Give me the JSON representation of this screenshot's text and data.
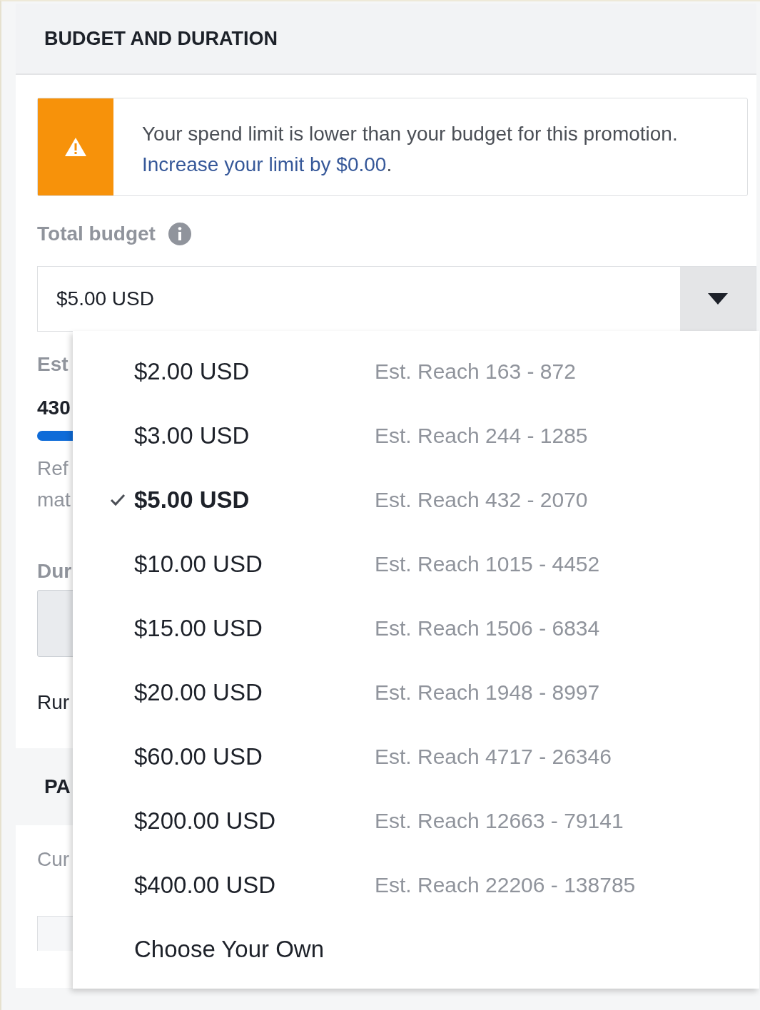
{
  "section": {
    "title": "BUDGET AND DURATION"
  },
  "warning": {
    "text": "Your spend limit is lower than your budget for this promotion.",
    "link": "Increase your limit by $0.00",
    "tail": "."
  },
  "total_budget": {
    "label": "Total budget",
    "value": "$5.00 USD"
  },
  "behind": {
    "est_label": "Est",
    "est_value": "430",
    "ref_line1": "Ref",
    "ref_line2": "mat",
    "duration_label": "Dur",
    "run_label": "Rur",
    "payment_title": "PA",
    "cur_label": "Cur"
  },
  "menu": {
    "items": [
      {
        "kind": "option",
        "amount": "$2.00 USD",
        "reach": "Est. Reach 163 - 872",
        "selected": false
      },
      {
        "kind": "option",
        "amount": "$3.00 USD",
        "reach": "Est. Reach 244 - 1285",
        "selected": false
      },
      {
        "kind": "option",
        "amount": "$5.00 USD",
        "reach": "Est. Reach 432 - 2070",
        "selected": true
      },
      {
        "kind": "option",
        "amount": "$10.00 USD",
        "reach": "Est. Reach 1015 - 4452",
        "selected": false
      },
      {
        "kind": "option",
        "amount": "$15.00 USD",
        "reach": "Est. Reach 1506 - 6834",
        "selected": false
      },
      {
        "kind": "option",
        "amount": "$20.00 USD",
        "reach": "Est. Reach 1948 - 8997",
        "selected": false
      },
      {
        "kind": "option",
        "amount": "$60.00 USD",
        "reach": "Est. Reach 4717 - 26346",
        "selected": false
      },
      {
        "kind": "option",
        "amount": "$200.00 USD",
        "reach": "Est. Reach 12663 - 79141",
        "selected": false
      },
      {
        "kind": "option",
        "amount": "$400.00 USD",
        "reach": "Est. Reach 22206 - 138785",
        "selected": false
      },
      {
        "kind": "custom",
        "amount": "Choose Your Own",
        "selected": false
      }
    ]
  }
}
